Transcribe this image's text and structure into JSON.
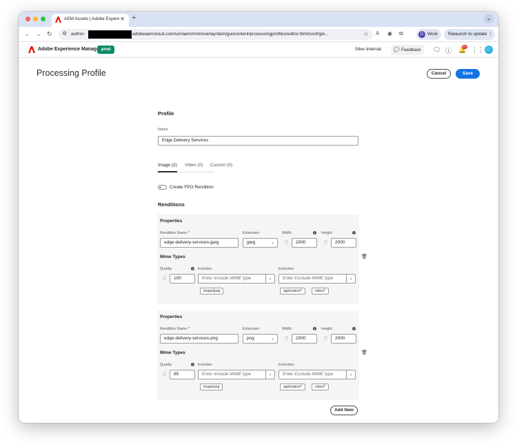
{
  "browser": {
    "tab_title": "AEM Assets | Adobe Experience Manager",
    "new_tab": "+",
    "url_start": "author-",
    "url_rest": "adobeaemcloud.com/ui#/aem/mnt/overlay/dam/gui/content/processingprofiles/editor.html/conf/glo...",
    "profile_initial": "D",
    "profile_name": "Work",
    "relaunch": "Relaunch to update"
  },
  "aem": {
    "app_name": "Adobe Experience Manager",
    "env_badge": "prod",
    "org": "Sites Internal",
    "feedback": "Feedback",
    "notification_count": "9+"
  },
  "page": {
    "title": "Processing Profile",
    "cancel": "Cancel",
    "save": "Save",
    "profile_heading": "Profile",
    "name_label": "Name",
    "name_value": "Edge Delivery Services",
    "tabs": [
      "Image (2)",
      "Video (0)",
      "Custom (0)"
    ],
    "fpo_label": "Create FPO Rendition",
    "renditions_heading": "Renditions",
    "add_new": "Add New"
  },
  "renditions": [
    {
      "properties_label": "Properties",
      "rendition_name_label": "Rendition Name *",
      "rendition_name": "edge-delivery-services-jpeg",
      "extension_label": "Extension",
      "extension": "jpeg",
      "width_label": "Width",
      "width": "2000",
      "height_label": "Height",
      "height": "2000",
      "mime_heading": "Mime Types",
      "quality_label": "Quality",
      "quality": "100",
      "includes_label": "Includes",
      "includes_placeholder": "Enter Include MIME type",
      "include_tags": [
        "image/jpeg"
      ],
      "excludes_label": "Excludes",
      "excludes_placeholder": "Enter Exclude MIME type",
      "exclude_tags": [
        "application/*",
        "video/*"
      ]
    },
    {
      "properties_label": "Properties",
      "rendition_name_label": "Rendition Name *",
      "rendition_name": "edge-delivery-services-png",
      "extension_label": "Extension",
      "extension": "png",
      "width_label": "Width",
      "width": "2000",
      "height_label": "Height",
      "height": "2000",
      "mime_heading": "Mime Types",
      "quality_label": "Quality",
      "quality": "85",
      "includes_label": "Includes",
      "includes_placeholder": "Enter Include MIME type",
      "include_tags": [
        "image/png"
      ],
      "excludes_label": "Excludes",
      "excludes_placeholder": "Enter Exclude MIME type",
      "exclude_tags": [
        "application/*",
        "video/*"
      ]
    }
  ],
  "colors": {
    "accent": "#1473e6",
    "env_badge": "#0d8a65",
    "card_bg": "#f5f5f5"
  },
  "icons": [
    "back-icon",
    "forward-icon",
    "reload-icon",
    "star-icon",
    "trash-icon",
    "info-icon",
    "chevron-down-icon",
    "bell-icon",
    "help-icon",
    "apps-icon",
    "feedback-icon"
  ]
}
